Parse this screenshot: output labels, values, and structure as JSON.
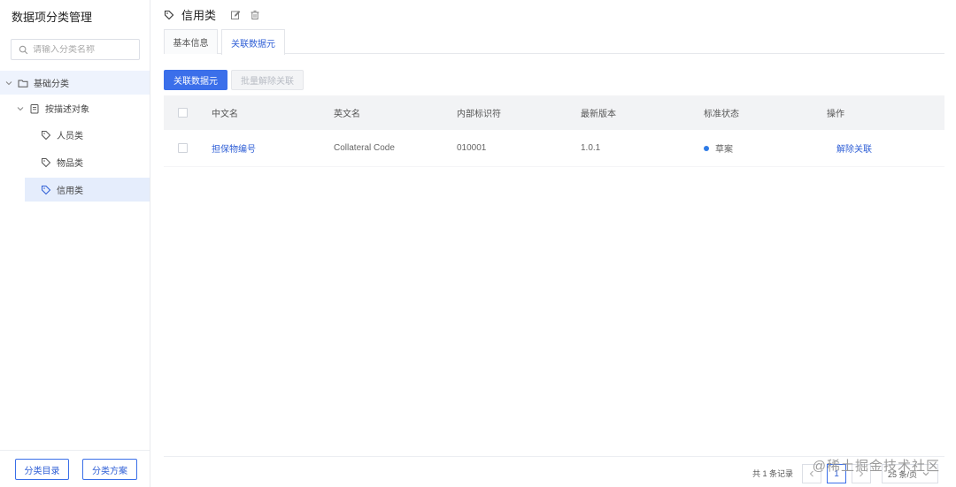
{
  "sidebar": {
    "title": "数据项分类管理",
    "search_placeholder": "请输入分类名称",
    "tree": {
      "root": "基础分类",
      "group": "按描述对象",
      "items": [
        "人员类",
        "物品类",
        "信用类"
      ]
    },
    "footer": {
      "catalog_button": "分类目录",
      "scheme_button": "分类方案"
    }
  },
  "header": {
    "title": "信用类"
  },
  "tabs": [
    "基本信息",
    "关联数据元"
  ],
  "toolbar": {
    "link_button": "关联数据元",
    "batch_unlink_button": "批量解除关联"
  },
  "table": {
    "columns": [
      "中文名",
      "英文名",
      "内部标识符",
      "最新版本",
      "标准状态",
      "操作"
    ],
    "rows": [
      {
        "name_cn": "担保物编号",
        "name_en": "Collateral Code",
        "internal_id": "010001",
        "version": "1.0.1",
        "status": "草案",
        "action": "解除关联"
      }
    ]
  },
  "pagination": {
    "total": "共 1 条记录",
    "current_page": "1",
    "page_size": "25 条/页"
  },
  "watermark": "@稀土掘金技术社区",
  "colors": {
    "primary": "#3b6fea",
    "status_dot": "#2e7be6",
    "selected_bg": "#e5edfc"
  }
}
